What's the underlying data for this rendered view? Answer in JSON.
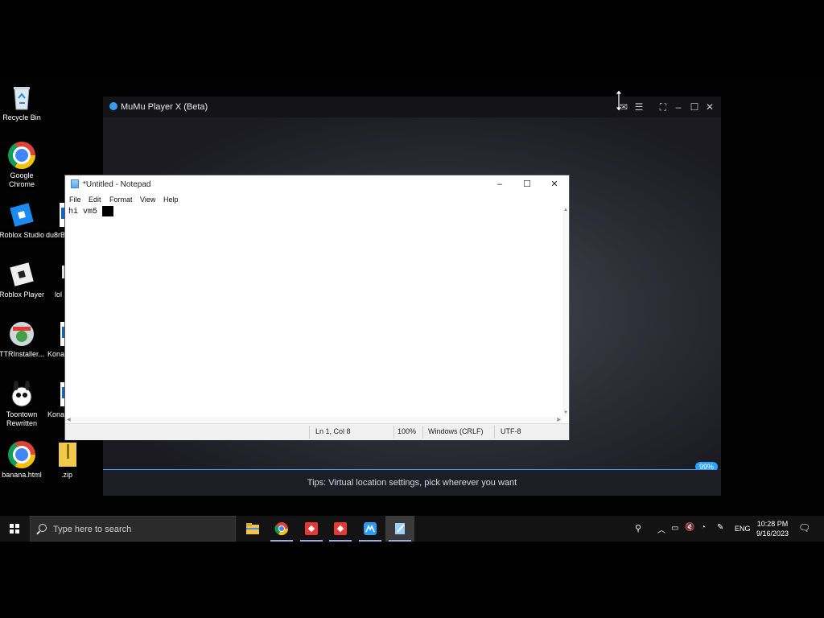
{
  "desktop": {
    "icons": [
      {
        "label": "Recycle Bin"
      },
      {
        "label": "Google Chrome"
      },
      {
        "label": "Roblox Studio"
      },
      {
        "label": "Roblox Player"
      },
      {
        "label": "TTRInstaller..."
      },
      {
        "label": "Toontown Rewritten"
      },
      {
        "label": "banana.html"
      },
      {
        "label": "du8rB"
      },
      {
        "label": "lol"
      },
      {
        "label": "Kona - 3163"
      },
      {
        "label": "Kona - 3240"
      },
      {
        "label": ".zip"
      }
    ]
  },
  "mumu": {
    "title": "MuMu Player X  (Beta)",
    "tip": "Tips: Virtual location settings, pick wherever you want",
    "progress_label": "99%",
    "progress": 0.99,
    "accent": "#2ea1ff"
  },
  "notepad": {
    "title": "*Untitled - Notepad",
    "menu": [
      "File",
      "Edit",
      "Format",
      "View",
      "Help"
    ],
    "content": "hi vm5",
    "status": {
      "position": "Ln 1, Col 8",
      "zoom": "100%",
      "line_ending": "Windows (CRLF)",
      "encoding": "UTF-8"
    }
  },
  "taskbar": {
    "search_placeholder": "Type here to search",
    "pinned_apps": [
      "file-explorer-icon",
      "chrome-icon",
      "roblox-studio-icon",
      "roblox-studio-icon",
      "mumu-player-icon",
      "notepad-icon"
    ],
    "language": "ENG",
    "time": "10:28 PM",
    "date": "9/16/2023"
  }
}
